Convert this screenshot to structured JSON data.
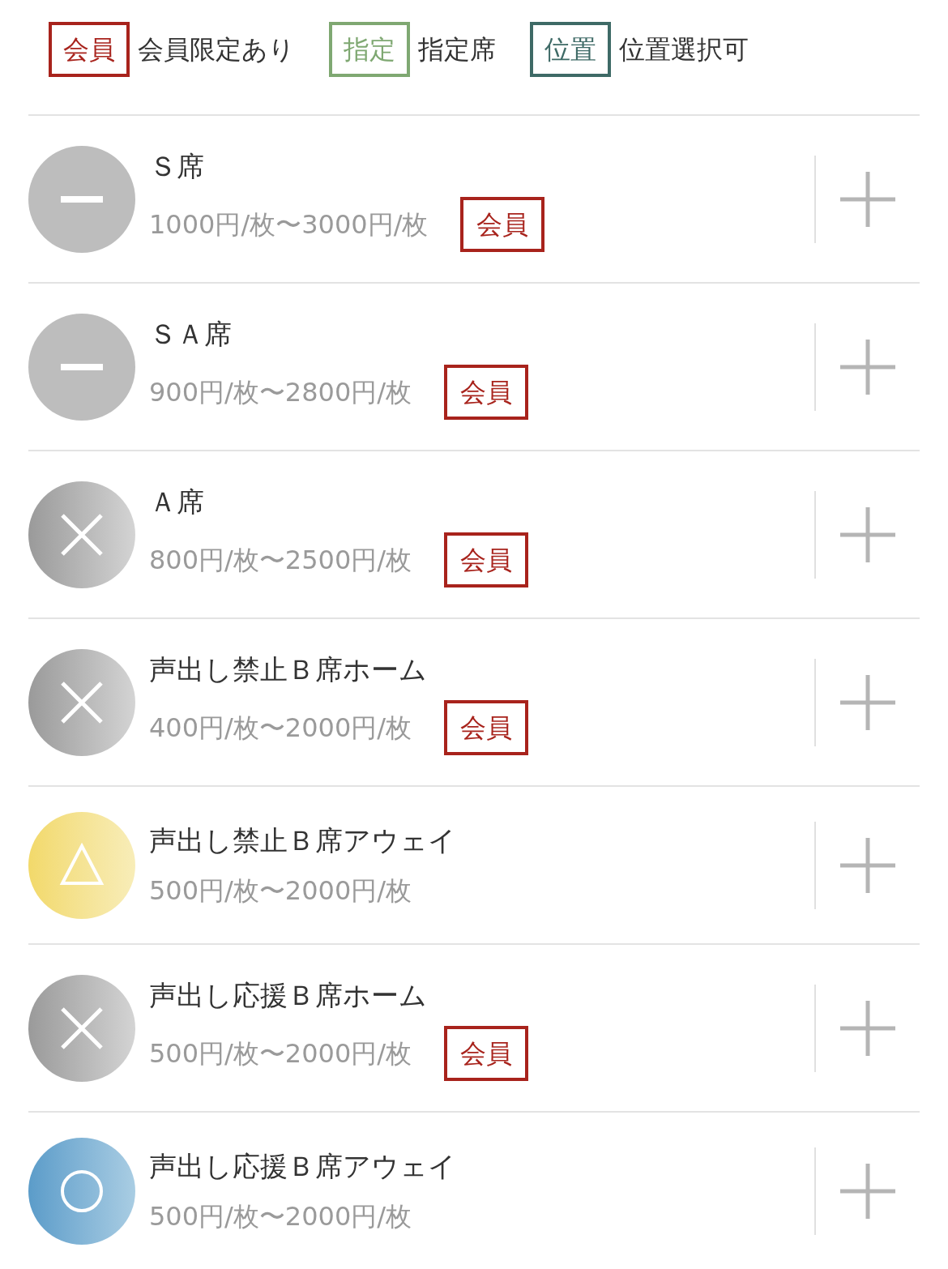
{
  "legend": [
    {
      "badge": "会員",
      "label": "会員限定あり",
      "color": "#a8231c"
    },
    {
      "badge": "指定",
      "label": "指定席",
      "color": "#7fa872"
    },
    {
      "badge": "位置",
      "label": "位置選択可",
      "color": "#3e6a66"
    }
  ],
  "seats": [
    {
      "name": "Ｓ席",
      "price": "1000円/枚〜3000円/枚",
      "kind": "unavailable",
      "badge": "会員"
    },
    {
      "name": "ＳＡ席",
      "price": "900円/枚〜2800円/枚",
      "kind": "unavailable",
      "badge": "会員"
    },
    {
      "name": "Ａ席",
      "price": "800円/枚〜2500円/枚",
      "kind": "soldout",
      "badge": "会員"
    },
    {
      "name": "声出し禁止Ｂ席ホーム",
      "price": "400円/枚〜2000円/枚",
      "kind": "soldout",
      "badge": "会員"
    },
    {
      "name": "声出し禁止Ｂ席アウェイ",
      "price": "500円/枚〜2000円/枚",
      "kind": "few"
    },
    {
      "name": "声出し応援Ｂ席ホーム",
      "price": "500円/枚〜2000円/枚",
      "kind": "soldout",
      "badge": "会員"
    },
    {
      "name": "声出し応援Ｂ席アウェイ",
      "price": "500円/枚〜2000円/枚",
      "kind": "available"
    }
  ]
}
